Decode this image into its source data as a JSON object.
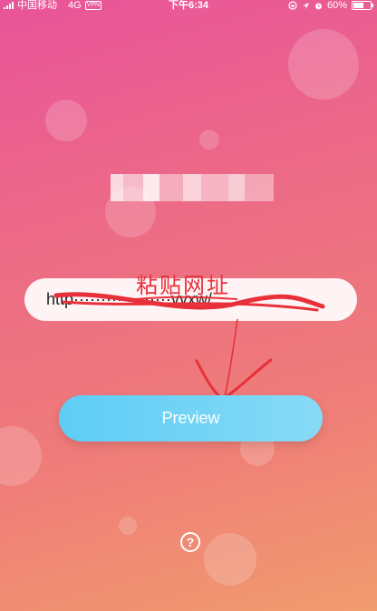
{
  "status_bar": {
    "carrier": "中国移动",
    "network": "4G",
    "vpn": "VPN",
    "time": "下午6:34",
    "battery_percent": "60%",
    "battery_level": 0.6
  },
  "form": {
    "url_value": "http··················vyxw/",
    "preview_label": "Preview"
  },
  "annotation": {
    "paste_hint": "粘贴网址"
  },
  "help": {
    "label": "?"
  },
  "colors": {
    "background_top": "#e9549a",
    "background_bottom": "#f19c6e",
    "button": "#6fd3f6",
    "annotation": "#e8303a"
  },
  "icons": {
    "signal": "signal-bars-icon",
    "location": "location-arrow-icon",
    "alarm": "alarm-icon",
    "battery": "battery-icon",
    "help": "help-circle-icon"
  }
}
